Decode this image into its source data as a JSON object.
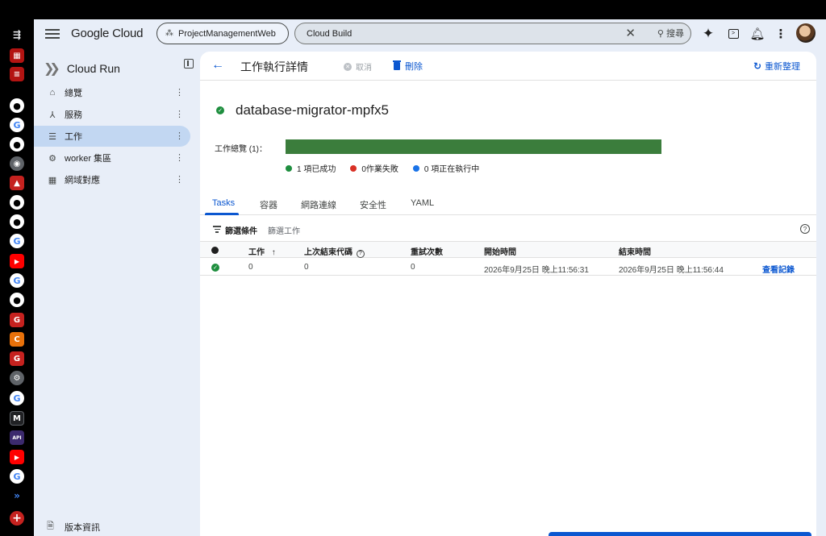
{
  "tabstrip": {
    "icons": [
      "sidebar-toggle-icon",
      "tab-grid-icon",
      "tab-search-icon",
      "github-icon",
      "google-icon",
      "github-icon",
      "web-icon",
      "cloud-icon",
      "github-icon",
      "github-icon",
      "google-icon",
      "youtube-icon",
      "google-icon",
      "github-icon",
      "g-icon",
      "c-icon",
      "g-icon",
      "settings-icon",
      "google-icon",
      "mk-icon",
      "api-icon",
      "youtube-icon",
      "google-icon",
      "cloud-run-icon",
      "new-tab-icon"
    ]
  },
  "topbar": {
    "brand": "Google Cloud",
    "project": "ProjectManagementWeb",
    "search_value": "Cloud Build",
    "search_button": "搜尋"
  },
  "sidebar": {
    "product": "Cloud Run",
    "items": [
      {
        "label": "總覽",
        "icon": "home-icon"
      },
      {
        "label": "服務",
        "icon": "services-icon"
      },
      {
        "label": "工作",
        "icon": "list-icon",
        "active": true
      },
      {
        "label": "worker 集區",
        "icon": "gears-icon"
      },
      {
        "label": "網域對應",
        "icon": "domain-icon"
      }
    ],
    "footer": "版本資訊"
  },
  "header": {
    "title": "工作執行詳情",
    "cancel": "取消",
    "delete": "刪除",
    "refresh": "重新整理"
  },
  "execution": {
    "name": "database-migrator-mpfx5",
    "summary_label": "工作總覽 (1)：",
    "progress_succeeded_fraction": 1.0,
    "legend": [
      {
        "label": "1 項已成功",
        "color": "#1e8e3e"
      },
      {
        "label": "0作業失敗",
        "color": "#d93025"
      },
      {
        "label": "0 項正在執行中",
        "color": "#1a73e8"
      }
    ]
  },
  "tabs": [
    "Tasks",
    "容器",
    "網路連線",
    "安全性",
    "YAML"
  ],
  "filter": {
    "label": "篩選條件",
    "placeholder": "篩選工作"
  },
  "table": {
    "columns": [
      "工作",
      "上次結束代碼",
      "重試次數",
      "開始時間",
      "結束時間"
    ],
    "rows": [
      {
        "task": "0",
        "exit_code": "0",
        "retries": "0",
        "start": "2026年9月25日 晚上11:56:31",
        "end": "2026年9月25日 晚上11:56:44",
        "action": "查看記錄"
      }
    ]
  }
}
